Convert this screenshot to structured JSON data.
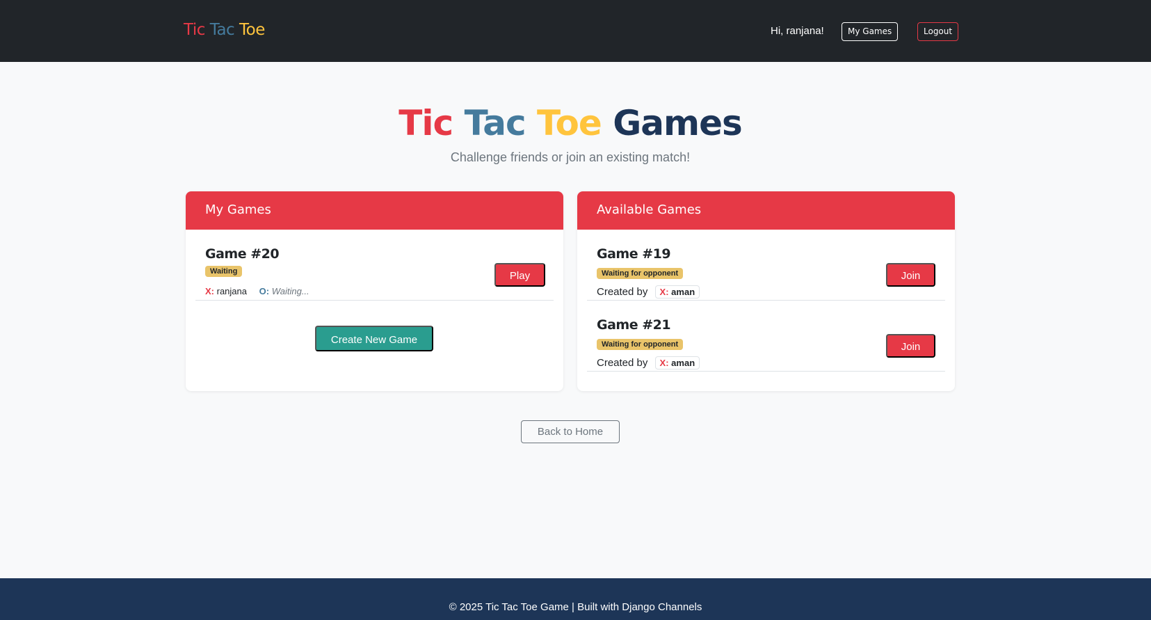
{
  "navbar": {
    "brand": {
      "word1": "Tic",
      "word2": "Tac",
      "word3": "Toe"
    },
    "greeting": "Hi, ranjana!",
    "my_games_label": "My Games",
    "logout_label": "Logout"
  },
  "hero": {
    "title": {
      "word1": "Tic",
      "word2": "Tac",
      "word3": "Toe",
      "word4": "Games"
    },
    "subtitle": "Challenge friends or join an existing match!"
  },
  "my_games": {
    "header": "My Games",
    "games": [
      {
        "title": "Game #20",
        "status": "Waiting",
        "x_label": "X:",
        "x_player": "ranjana",
        "o_label": "O:",
        "o_player": "Waiting...",
        "action": "Play"
      }
    ],
    "create_label": "Create New Game"
  },
  "available_games": {
    "header": "Available Games",
    "games": [
      {
        "title": "Game #19",
        "status": "Waiting for opponent",
        "created_by": "Created by",
        "x_label": "X:",
        "creator": "aman",
        "action": "Join"
      },
      {
        "title": "Game #21",
        "status": "Waiting for opponent",
        "created_by": "Created by",
        "x_label": "X:",
        "creator": "aman",
        "action": "Join"
      }
    ]
  },
  "back_label": "Back to Home",
  "footer": "© 2025 Tic Tac Toe Game | Built with Django Channels",
  "colors": {
    "red": "#e63946",
    "blue": "#457b9d",
    "yellow": "#ffc43d",
    "navy": "#1d3557",
    "teal": "#2a9d8f",
    "badge": "#e9c46a",
    "dark": "#212529"
  }
}
